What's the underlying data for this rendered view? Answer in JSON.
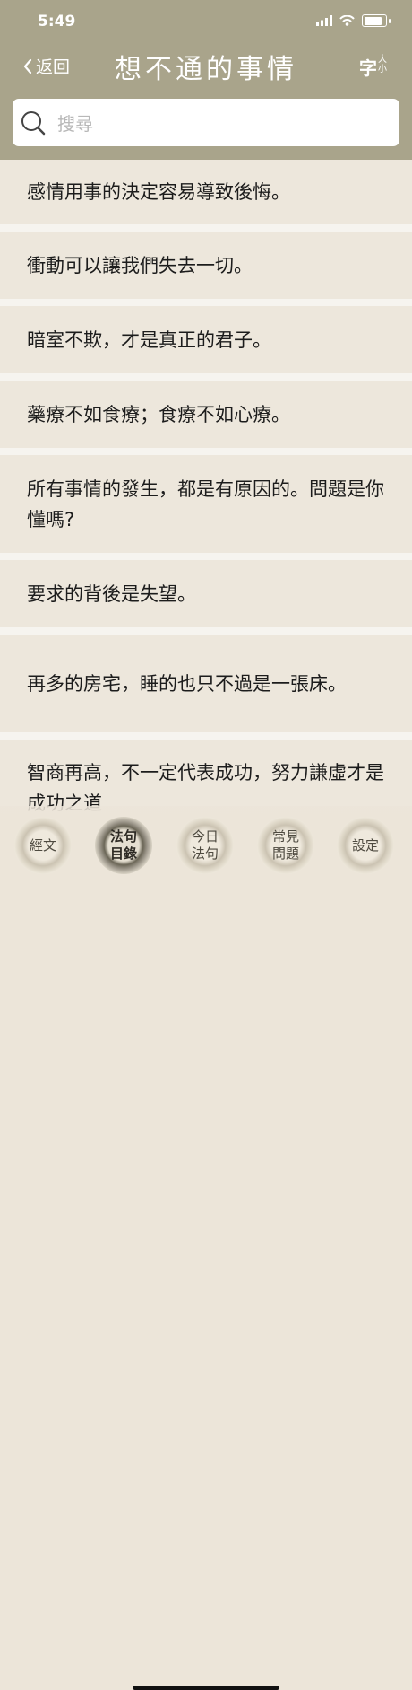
{
  "status": {
    "time": "5:49"
  },
  "header": {
    "back_label": "返回",
    "title": "想不通的事情",
    "font_size_main": "字",
    "font_size_top": "大",
    "font_size_bottom": "小"
  },
  "search": {
    "placeholder": "搜尋"
  },
  "items": [
    "感情用事的決定容易導致後悔。",
    "衝動可以讓我們失去一切。",
    "暗室不欺，才是真正的君子。",
    "藥療不如食療；食療不如心療。",
    "所有事情的發生，都是有原因的。問題是你懂嗎?",
    "要求的背後是失望。",
    "再多的房宅，睡的也只不過是一張床。",
    "智商再高，不一定代表成功，努力謙虛才是成功之道"
  ],
  "tabs": [
    {
      "line1": "經文",
      "line2": ""
    },
    {
      "line1": "法句",
      "line2": "目錄"
    },
    {
      "line1": "今日",
      "line2": "法句"
    },
    {
      "line1": "常見",
      "line2": "問題"
    },
    {
      "line1": "設定",
      "line2": ""
    }
  ],
  "colors": {
    "header": "#a9a48b",
    "row": "#ede7dc",
    "separator": "#f6f4ef"
  }
}
